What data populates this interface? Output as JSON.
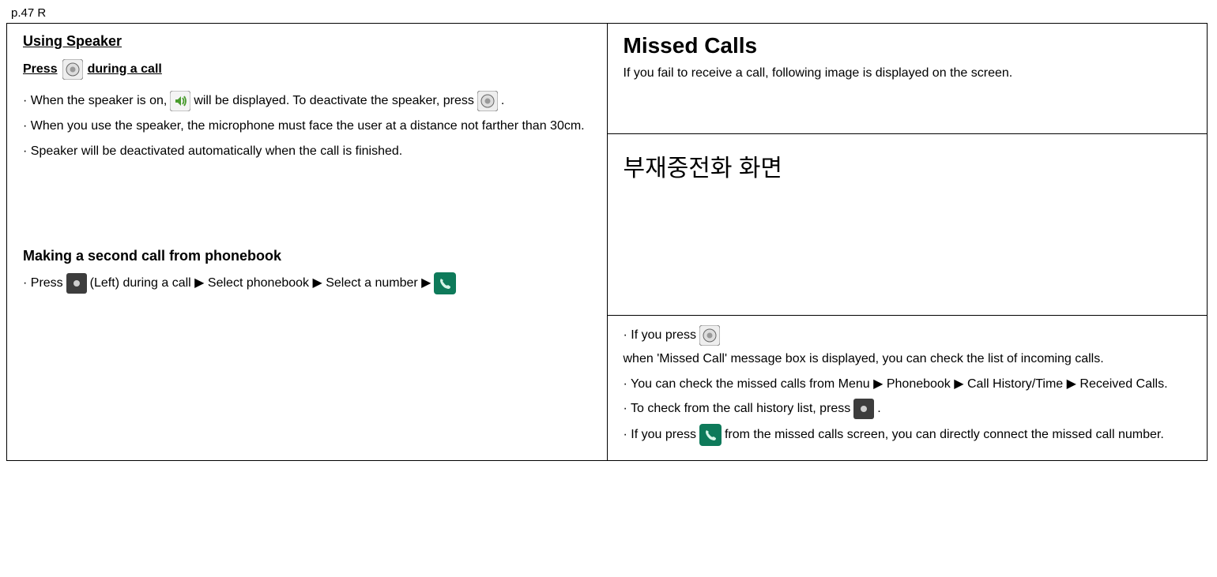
{
  "page_number": "p.47 R",
  "left": {
    "heading1": "Using Speaker",
    "press_prefix": "Press ",
    "press_suffix": " during a call",
    "bullet1_a": "· When the speaker is on, ",
    "bullet1_b": " will be displayed. To deactivate the speaker, press ",
    "bullet1_c": ".",
    "bullet2": "· When you use the speaker, the microphone must face the user at a distance not farther than 30cm.",
    "bullet3": "· Speaker will be deactivated automatically when the call is finished.",
    "heading2": "Making a second call from phonebook",
    "b2_1": "· Press ",
    "b2_2": "(Left) during a call ▶ Select phonebook ▶ Select a number ▶ "
  },
  "right_top": {
    "heading": "Missed Calls",
    "text": "If you fail to receive a call, following image is displayed on the screen."
  },
  "right_mid": {
    "ko": "부재중전화 화면"
  },
  "right_bot": {
    "r1a": "· If you press ",
    "r1b": " when 'Missed Call' message box is displayed, you can check the list of incoming calls.",
    "r2": "· You can check the missed calls from Menu ▶ Phonebook ▶ Call History/Time ▶ Received Calls.",
    "r3a": "· To check from the call history list, press ",
    "r3b": ".",
    "r4a": "· If you press ",
    "r4b": " from the missed calls screen, you can directly connect the missed call number."
  }
}
